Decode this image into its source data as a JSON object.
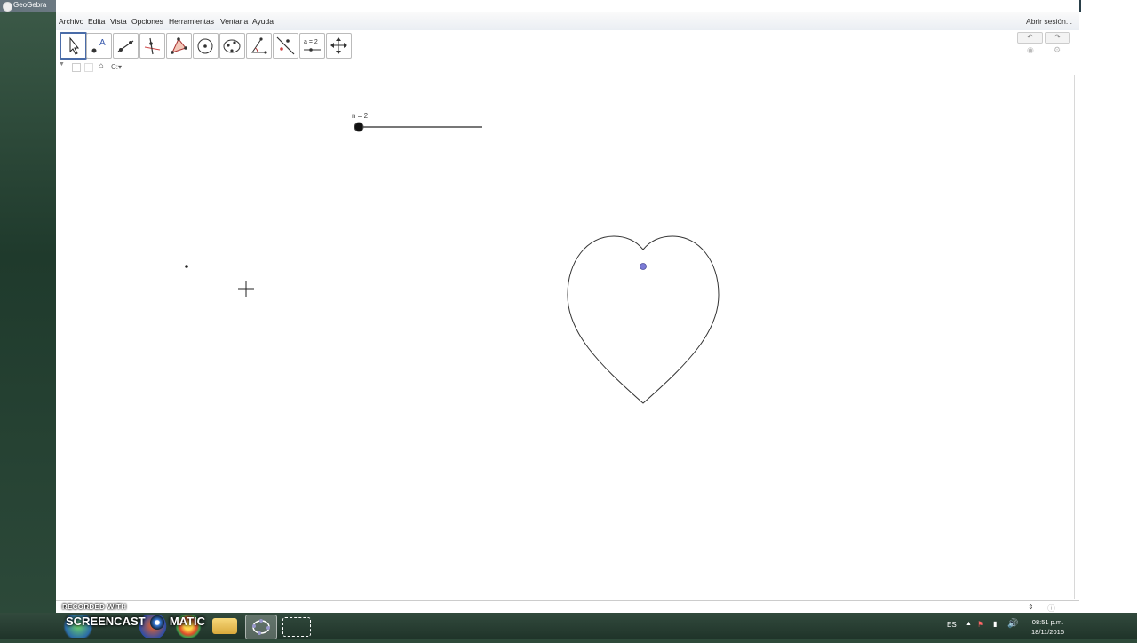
{
  "window": {
    "title": "GeoGebra"
  },
  "menu": {
    "items": [
      "Archivo",
      "Edita",
      "Vista",
      "Opciones",
      "Herramientas",
      "Ventana",
      "Ayuda"
    ],
    "login": "Abrir sesión..."
  },
  "toolbar": {
    "tools": [
      "move-tool",
      "point-tool",
      "line-tool",
      "perpendicular-line-tool",
      "polygon-tool",
      "circle-tool",
      "conic-tool",
      "angle-tool",
      "reflect-tool",
      "slider-tool",
      "move-graphics-view-tool"
    ],
    "slider_label": "a = 2"
  },
  "subbar": {
    "coord_label": "C:"
  },
  "canvas": {
    "slider_caption": "n = 2",
    "slider_value": 2
  },
  "taskbar": {
    "recorded_with": "RECORDED WITH",
    "logo_left": "SCREENCAST",
    "logo_right": "MATIC",
    "language": "ES",
    "time": "08:51 p.m.",
    "date": "18/11/2016"
  },
  "colors": {
    "accent_point": "#7b7bd6",
    "selected_tool_border": "#4a6ca8"
  }
}
